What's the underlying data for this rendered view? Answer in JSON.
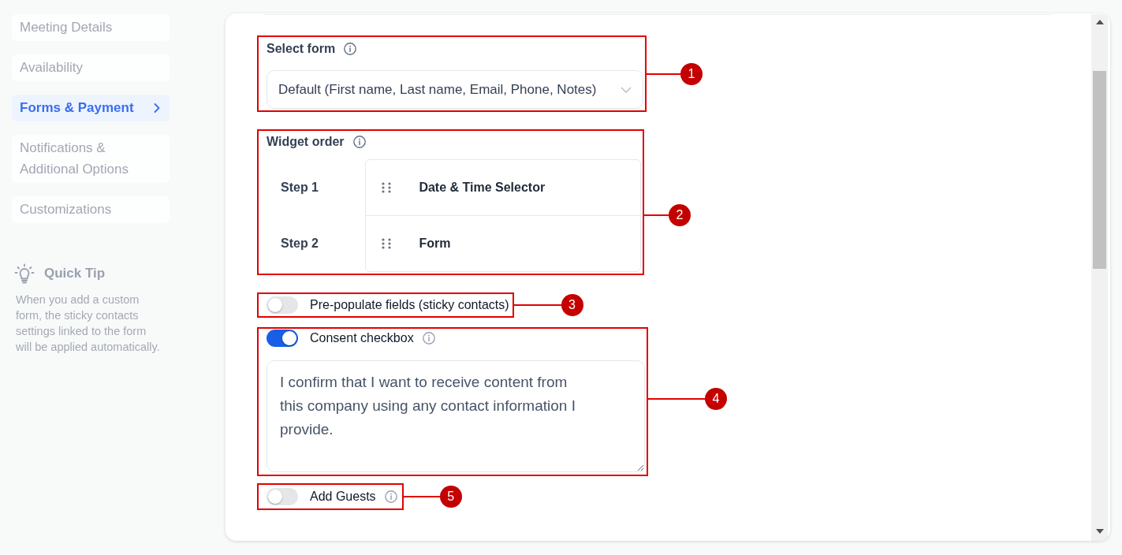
{
  "sidebar": {
    "items": [
      {
        "label": "Meeting Details",
        "selected": false
      },
      {
        "label": "Availability",
        "selected": false
      },
      {
        "label": "Forms & Payment",
        "selected": true
      },
      {
        "label": "Notifications & Additional Options",
        "selected": false
      },
      {
        "label": "Customizations",
        "selected": false
      }
    ],
    "tip": {
      "title": "Quick Tip",
      "text": "When you add a custom form, the sticky contacts settings linked to the form will be applied automatically."
    }
  },
  "sections": [
    {
      "kind": "select",
      "label": "Select form",
      "info": true,
      "value": "Default (First name, Last name, Email, Phone, Notes)",
      "callout": "1"
    },
    {
      "kind": "widget_order",
      "label": "Widget order",
      "info": true,
      "steps": [
        {
          "label": "Step 1",
          "widget": "Date & Time Selector"
        },
        {
          "label": "Step 2",
          "widget": "Form"
        }
      ],
      "callout": "2"
    },
    {
      "kind": "toggle",
      "label": "Pre-populate fields (sticky contacts)",
      "on": false,
      "info": false,
      "callout": "3"
    },
    {
      "kind": "toggle",
      "label": "Consent checkbox",
      "on": true,
      "info": true,
      "field_value": "I confirm that I want to receive content from this company using any contact information I provide.",
      "callout": "4"
    },
    {
      "kind": "toggle",
      "label": "Add Guests",
      "on": false,
      "info": true,
      "callout": "5"
    }
  ]
}
